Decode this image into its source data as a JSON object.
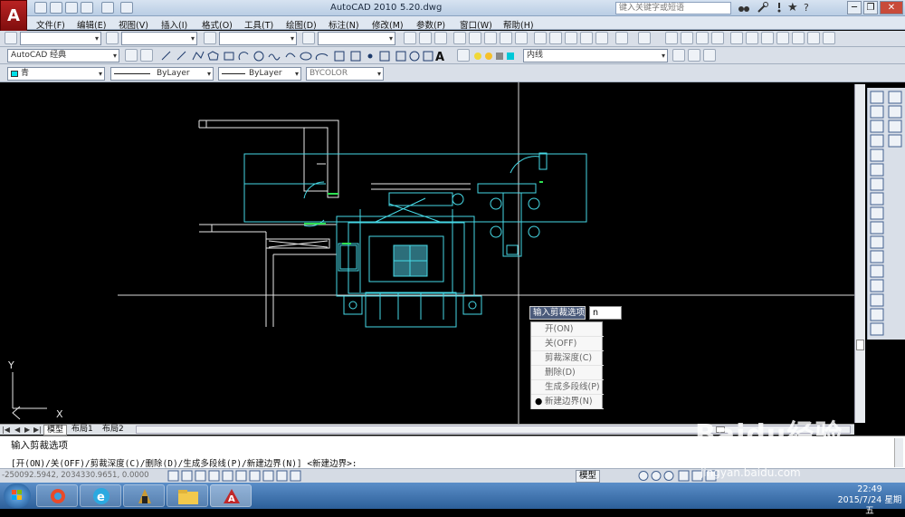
{
  "titlebar": {
    "app_title": "AutoCAD 2010",
    "file_title": "5.20.dwg",
    "search_placeholder": "键入关键字或短语",
    "minimize": "─",
    "restore": "❐",
    "close": "✕"
  },
  "menu": [
    "文件(F)",
    "编辑(E)",
    "视图(V)",
    "插入(I)",
    "格式(O)",
    "工具(T)",
    "绘图(D)",
    "标注(N)",
    "修改(M)",
    "参数(P)",
    "窗口(W)",
    "帮助(H)"
  ],
  "toolbar": {
    "workspace": "AutoCAD 经典",
    "color": "青",
    "linetype": "ByLayer",
    "lineweight": "ByLayer",
    "plotstyle": "BYCOLOR",
    "layer": "内线"
  },
  "prompt": {
    "label": "输入剪裁选项",
    "input_value": "n",
    "options": [
      "开(ON)",
      "关(OFF)",
      "剪裁深度(C)",
      "删除(D)",
      "生成多段线(P)",
      "新建边界(N)"
    ],
    "selected": "新建边界(N)"
  },
  "tabs": [
    "模型",
    "布局1",
    "布局2"
  ],
  "command": {
    "line1": "输入剪裁选项",
    "line2": "[开(ON)/关(OFF)/剪裁深度(C)/删除(D)/生成多段线(P)/新建边界(N)] <新建边界>:"
  },
  "status": {
    "coords": "-250092.5942, 2034330.9651, 0.0000",
    "model": "模型"
  },
  "taskbar": {
    "time": "22:49",
    "date": "2015/7/24 星期五"
  },
  "watermark": {
    "brand": "Baidu经验",
    "url": "jingyan.baidu.com"
  },
  "ucs": {
    "x_label": "X",
    "y_label": "Y"
  },
  "colors": {
    "drawing_line": "#46d9e6",
    "drawing_white": "#e9e9e9",
    "drawing_green": "#2ee052",
    "canvas_bg": "#000000"
  }
}
